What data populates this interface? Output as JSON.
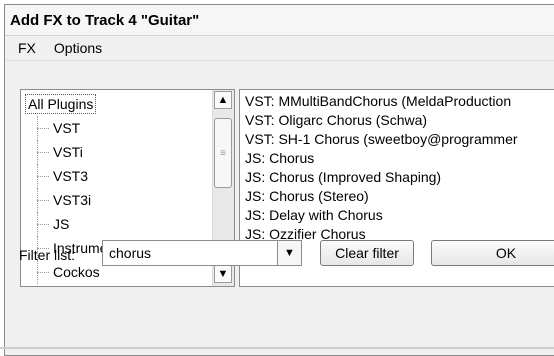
{
  "window": {
    "title": "Add FX to Track 4 \"Guitar\""
  },
  "menu": [
    {
      "label": "FX"
    },
    {
      "label": "Options"
    }
  ],
  "tree": {
    "items": [
      {
        "label": "All Plugins"
      },
      {
        "label": "VST"
      },
      {
        "label": "VSTi"
      },
      {
        "label": "VST3"
      },
      {
        "label": "VST3i"
      },
      {
        "label": "JS"
      },
      {
        "label": "Instruments"
      },
      {
        "label": "Cockos"
      }
    ]
  },
  "plugins": [
    "VST: MMultiBandChorus (MeldaProduction",
    "VST: Oligarc Chorus (Schwa)",
    "VST: SH-1 Chorus (sweetboy@programmer",
    "JS: Chorus",
    "JS: Chorus (Improved Shaping)",
    "JS: Chorus (Stereo)",
    "JS: Delay with Chorus",
    "JS: Ozzifier Chorus"
  ],
  "filter": {
    "label": "Filter list:",
    "value": "chorus"
  },
  "buttons": {
    "clear": "Clear filter",
    "ok": "OK"
  },
  "icons": {
    "scroll_up": "▲",
    "scroll_down": "▼",
    "grip": "≡",
    "combo": "▼"
  }
}
